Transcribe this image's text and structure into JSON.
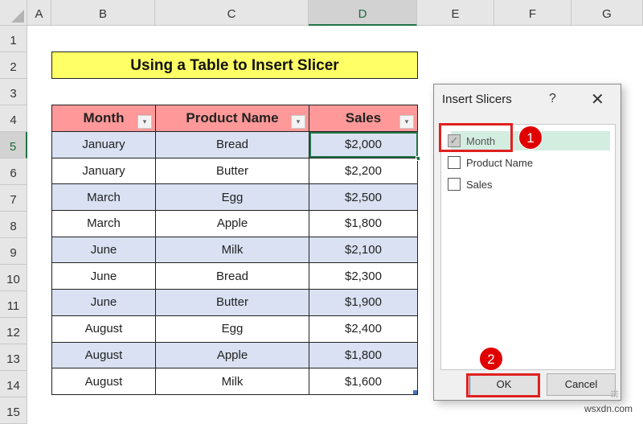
{
  "columns": [
    "A",
    "B",
    "C",
    "D",
    "E",
    "F",
    "G"
  ],
  "selected_column": "D",
  "rows": [
    "1",
    "2",
    "3",
    "4",
    "5",
    "6",
    "7",
    "8",
    "9",
    "10",
    "11",
    "12",
    "13",
    "14",
    "15"
  ],
  "selected_row": "5",
  "title": "Using a Table to Insert Slicer",
  "table": {
    "headers": [
      "Month",
      "Product Name",
      "Sales"
    ],
    "rows": [
      [
        "January",
        "Bread",
        "$2,000"
      ],
      [
        "January",
        "Butter",
        "$2,200"
      ],
      [
        "March",
        "Egg",
        "$2,500"
      ],
      [
        "March",
        "Apple",
        "$1,800"
      ],
      [
        "June",
        "Milk",
        "$2,100"
      ],
      [
        "June",
        "Bread",
        "$2,300"
      ],
      [
        "June",
        "Butter",
        "$1,900"
      ],
      [
        "August",
        "Egg",
        "$2,400"
      ],
      [
        "August",
        "Apple",
        "$1,800"
      ],
      [
        "August",
        "Milk",
        "$1,600"
      ]
    ]
  },
  "icons": {
    "dropdown": "▾",
    "check": "✓",
    "close": "✕",
    "help": "?"
  },
  "dialog": {
    "title": "Insert Slicers",
    "fields": [
      {
        "label": "Month",
        "checked": true
      },
      {
        "label": "Product Name",
        "checked": false
      },
      {
        "label": "Sales",
        "checked": false
      }
    ],
    "ok_label": "OK",
    "cancel_label": "Cancel"
  },
  "annotations": {
    "step1": "1",
    "step2": "2",
    "highlight_color": "#e02020"
  },
  "watermark": "wsxdn.com"
}
